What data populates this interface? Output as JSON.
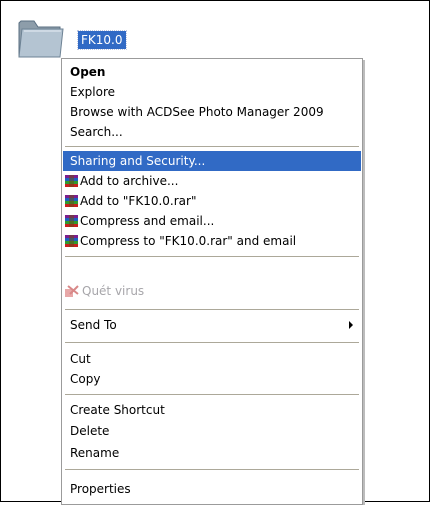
{
  "folder": {
    "name": "FK10.0",
    "icon": "folder-icon"
  },
  "menu": {
    "open": "Open",
    "explore": "Explore",
    "acdsee": "Browse with ACDSee Photo Manager 2009",
    "search": "Search...",
    "sharing": "Sharing and Security...",
    "add_archive": "Add to archive...",
    "add_rar": "Add to \"FK10.0.rar\"",
    "compress_email": "Compress and email...",
    "compress_rar_email": "Compress to \"FK10.0.rar\" and email",
    "quet_virus": "Quét virus",
    "send_to": "Send To",
    "cut": "Cut",
    "copy": "Copy",
    "create_shortcut": "Create Shortcut",
    "delete": "Delete",
    "rename": "Rename",
    "properties": "Properties"
  },
  "colors": {
    "highlight": "#316ac5",
    "disabled": "#a7a6aa"
  }
}
